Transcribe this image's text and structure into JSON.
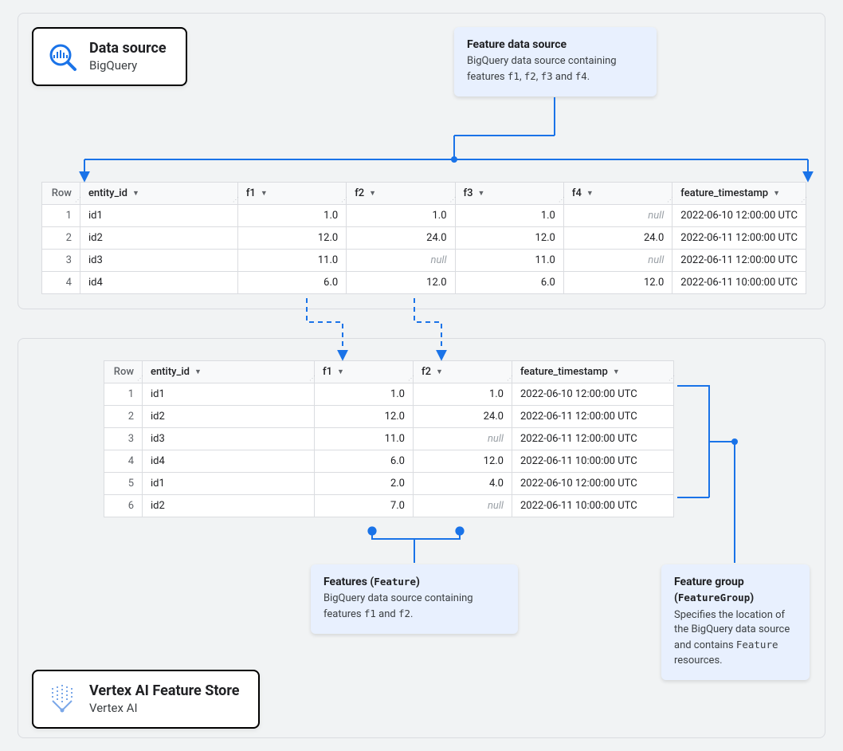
{
  "source_card": {
    "title": "Data source",
    "subtitle": "BigQuery"
  },
  "store_card": {
    "title": "Vertex AI Feature Store",
    "subtitle": "Vertex AI"
  },
  "callout_source": {
    "title": "Feature data source",
    "text_a": "BigQuery data source containing features ",
    "text_b": ", ",
    "text_c": ", ",
    "text_d": " and ",
    "text_e": ".",
    "f1": "f1",
    "f2": "f2",
    "f3": "f3",
    "f4": "f4"
  },
  "callout_features": {
    "title_a": "Features (",
    "title_mono": "Feature",
    "title_b": ")",
    "text_a": "BigQuery data source containing features ",
    "text_b": " and ",
    "text_c": ".",
    "f1": "f1",
    "f2": "f2"
  },
  "callout_group": {
    "title_a": "Feature group (",
    "title_mono": "FeatureGroup",
    "title_b": ")",
    "text_a": "Specifies the location of the BigQuery data source and contains ",
    "mono": "Feature",
    "text_b": " resources."
  },
  "table1": {
    "headers": {
      "row": "Row",
      "entity": "entity_id",
      "f1": "f1",
      "f2": "f2",
      "f3": "f3",
      "f4": "f4",
      "ts": "feature_timestamp"
    },
    "null_label": "null",
    "rows": [
      {
        "n": "1",
        "id": "id1",
        "f1": "1.0",
        "f2": "1.0",
        "f3": "1.0",
        "f4": null,
        "ts": "2022-06-10 12:00:00 UTC"
      },
      {
        "n": "2",
        "id": "id2",
        "f1": "12.0",
        "f2": "24.0",
        "f3": "12.0",
        "f4": "24.0",
        "ts": "2022-06-11 12:00:00 UTC"
      },
      {
        "n": "3",
        "id": "id3",
        "f1": "11.0",
        "f2": null,
        "f3": "11.0",
        "f4": null,
        "ts": "2022-06-11 12:00:00 UTC"
      },
      {
        "n": "4",
        "id": "id4",
        "f1": "6.0",
        "f2": "12.0",
        "f3": "6.0",
        "f4": "12.0",
        "ts": "2022-06-11 10:00:00 UTC"
      }
    ]
  },
  "table2": {
    "headers": {
      "row": "Row",
      "entity": "entity_id",
      "f1": "f1",
      "f2": "f2",
      "ts": "feature_timestamp"
    },
    "null_label": "null",
    "rows": [
      {
        "n": "1",
        "id": "id1",
        "f1": "1.0",
        "f2": "1.0",
        "ts": "2022-06-10 12:00:00 UTC"
      },
      {
        "n": "2",
        "id": "id2",
        "f1": "12.0",
        "f2": "24.0",
        "ts": "2022-06-11 12:00:00 UTC"
      },
      {
        "n": "3",
        "id": "id3",
        "f1": "11.0",
        "f2": null,
        "ts": "2022-06-11 12:00:00 UTC"
      },
      {
        "n": "4",
        "id": "id4",
        "f1": "6.0",
        "f2": "12.0",
        "ts": "2022-06-11 10:00:00 UTC"
      },
      {
        "n": "5",
        "id": "id1",
        "f1": "2.0",
        "f2": "4.0",
        "ts": "2022-06-10 12:00:00 UTC"
      },
      {
        "n": "6",
        "id": "id2",
        "f1": "7.0",
        "f2": null,
        "ts": "2022-06-11 10:00:00 UTC"
      }
    ]
  }
}
